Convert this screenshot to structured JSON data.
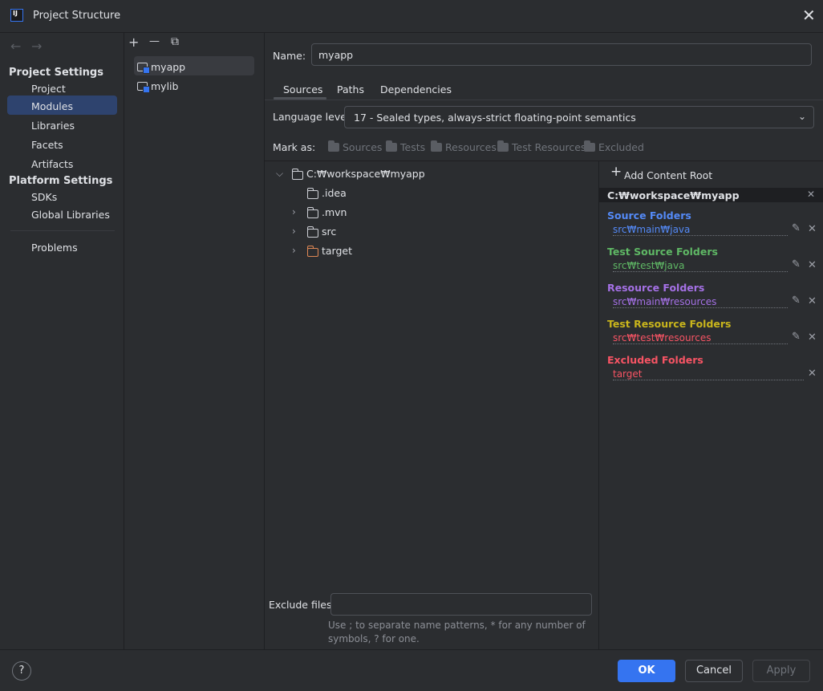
{
  "window": {
    "title": "Project Structure",
    "app_icon_text": "IJ"
  },
  "sidebar": {
    "back_arrow": "←",
    "forward_arrow": "→",
    "project_settings_header": "Project Settings",
    "project_settings_items": [
      "Project",
      "Modules",
      "Libraries",
      "Facets",
      "Artifacts"
    ],
    "platform_settings_header": "Platform Settings",
    "platform_settings_items": [
      "SDKs",
      "Global Libraries"
    ],
    "problems": "Problems",
    "selected": "Modules"
  },
  "modules_panel": {
    "add": "+",
    "remove": "—",
    "copy": "⧉",
    "modules": [
      "myapp",
      "mylib"
    ],
    "selected": "myapp"
  },
  "main": {
    "name_label": "Name:",
    "name_value": "myapp",
    "tabs": [
      "Sources",
      "Paths",
      "Dependencies"
    ],
    "active_tab": "Sources",
    "language_level_label": "Language level:",
    "language_level_value": "17 - Sealed types, always-strict floating-point semantics",
    "mark_as_label": "Mark as:",
    "mark_as_options": [
      "Sources",
      "Tests",
      "Resources",
      "Test Resources",
      "Excluded"
    ],
    "tree": {
      "root": "C:₩workspace₩myapp",
      "children": [
        ".idea",
        ".mvn",
        "src",
        "target"
      ]
    },
    "exclude_files_label": "Exclude files:",
    "exclude_files_value": "",
    "exclude_hint": "Use ; to separate name patterns, * for any number of symbols, ? for one."
  },
  "right_panel": {
    "add_content_root": "Add Content Root",
    "content_root": "C:₩workspace₩myapp",
    "source_folders_header": "Source Folders",
    "source_folders_path": "src₩main₩java",
    "test_source_folders_header": "Test Source Folders",
    "test_source_folders_path": "src₩test₩java",
    "resource_folders_header": "Resource Folders",
    "resource_folders_path": "src₩main₩resources",
    "test_resource_folders_header": "Test Resource Folders",
    "test_resource_folders_path": "src₩test₩resources",
    "excluded_folders_header": "Excluded Folders",
    "excluded_folders_path": "target",
    "colors": {
      "source": "#548af7",
      "test_source": "#5fb865",
      "resource": "#a571e6",
      "test_resource": "#c9b51c",
      "excluded": "#f75464"
    }
  },
  "footer": {
    "help": "?",
    "ok": "OK",
    "cancel": "Cancel",
    "apply": "Apply"
  },
  "colors": {
    "accent": "#3574f0",
    "background": "#2b2d30",
    "selection": "#2e436e"
  }
}
